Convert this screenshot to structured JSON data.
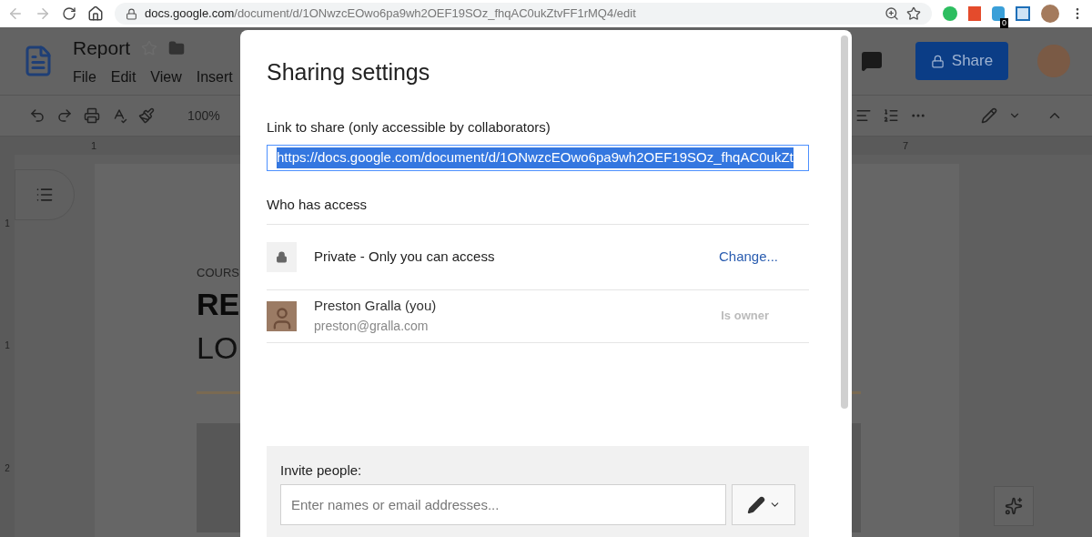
{
  "browser": {
    "url_host": "docs.google.com",
    "url_path": "/document/d/1ONwzcEOwo6pa9wh2OEF19SOz_fhqAC0ukZtvFF1rMQ4/edit",
    "extension_badge": "0"
  },
  "docs": {
    "title": "Report",
    "starred": false,
    "menus": [
      "File",
      "Edit",
      "View",
      "Insert"
    ],
    "zoom": "100%",
    "share_button": "Share",
    "ruler_h": [
      "1",
      "7"
    ],
    "ruler_v": [
      "1",
      "1",
      "2"
    ],
    "page_lines": [
      {
        "kind": "kicker",
        "text": "COURS"
      },
      {
        "kind": "title",
        "text": "RE"
      },
      {
        "kind": "subtitle",
        "text": "LO"
      }
    ]
  },
  "dialog": {
    "title": "Sharing settings",
    "link_label": "Link to share (only accessible by collaborators)",
    "link_value": "https://docs.google.com/document/d/1ONwzcEOwo6pa9wh2OEF19SOz_fhqAC0ukZt",
    "link_selected": true,
    "access_heading": "Who has access",
    "access": {
      "label": "Private - Only you can access",
      "action": "Change..."
    },
    "people": [
      {
        "name": "Preston Gralla (you)",
        "email": "preston@gralla.com",
        "role": "Is owner"
      }
    ],
    "invite": {
      "label": "Invite people:",
      "placeholder": "Enter names or email addresses..."
    }
  }
}
